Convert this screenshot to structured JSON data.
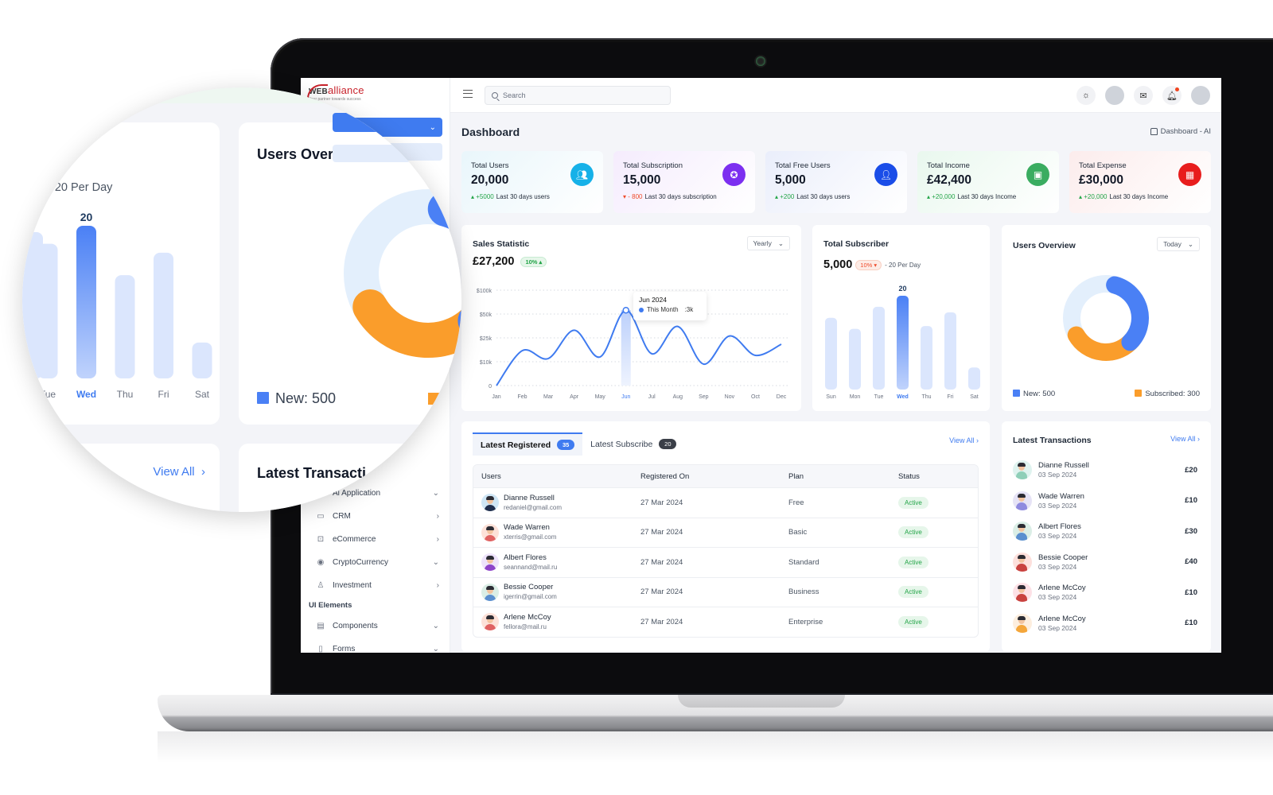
{
  "brand": {
    "name_prefix": "WEB",
    "name_suffix": "alliance",
    "tagline": "Your partner towards success"
  },
  "topbar": {
    "search_placeholder": "Search",
    "icons": [
      "sun-icon",
      "avatar-placeholder",
      "mail-icon",
      "bell-icon",
      "user-avatar"
    ]
  },
  "page": {
    "title": "Dashboard",
    "breadcrumb": "Dashboard - AI"
  },
  "sidebar": {
    "items": [
      {
        "label": "Ai Application",
        "icon": "robot-icon",
        "chevron": "down"
      },
      {
        "label": "CRM",
        "icon": "monitor-icon",
        "chevron": "right"
      },
      {
        "label": "eCommerce",
        "icon": "cart-icon",
        "chevron": "right"
      },
      {
        "label": "CryptoCurrency",
        "icon": "coin-icon",
        "chevron": "down"
      },
      {
        "label": "Investment",
        "icon": "investment-icon",
        "chevron": "right"
      }
    ],
    "section_label": "UI Elements",
    "section_items": [
      {
        "label": "Components",
        "icon": "components-icon",
        "chevron": "down"
      },
      {
        "label": "Forms",
        "icon": "forms-icon",
        "chevron": "down"
      }
    ]
  },
  "stats": [
    {
      "label": "Total Users",
      "value": "20,000",
      "delta": "+5000",
      "delta_dir": "up",
      "note": "Last 30 days users",
      "icon": "users-icon",
      "icon_color": "#16b1e8",
      "bg": "#e9f6fb"
    },
    {
      "label": "Total Subscription",
      "value": "15,000",
      "delta": "- 800",
      "delta_dir": "down",
      "note": "Last 30 days subscription",
      "icon": "award-icon",
      "icon_color": "#7c2ff0",
      "bg": "#f5ecfd"
    },
    {
      "label": "Total Free Users",
      "value": "5,000",
      "delta": "+200",
      "delta_dir": "up",
      "note": "Last 30 days users",
      "icon": "user-group-icon",
      "icon_color": "#1a4de8",
      "bg": "#eaeefb"
    },
    {
      "label": "Total Income",
      "value": "£42,400",
      "delta": "+20,000",
      "delta_dir": "up",
      "note": "Last 30 days Income",
      "icon": "wallet-icon",
      "icon_color": "#3aac60",
      "bg": "#e9f8ee"
    },
    {
      "label": "Total Expense",
      "value": "£30,000",
      "delta": "+20,000",
      "delta_dir": "up",
      "note": "Last 30 days Income",
      "icon": "expense-icon",
      "icon_color": "#e81d1d",
      "bg": "#fcecec"
    }
  ],
  "sales": {
    "title": "Sales Statistic",
    "value": "£27,200",
    "change": "10%",
    "period": "Yearly",
    "tooltip": {
      "title": "Jun 2024",
      "series": "This Month",
      "value": ":3k"
    }
  },
  "subscriber": {
    "title": "Total Subscriber",
    "value": "5,000",
    "change": "10%",
    "note": "- 20 Per Day",
    "highlight_label": "20"
  },
  "overview": {
    "title": "Users Overview",
    "period": "Today",
    "legend": [
      {
        "label": "New: 500",
        "color": "#4a80f5"
      },
      {
        "label": "Subscribed: 300",
        "color": "#fa9d2b"
      }
    ]
  },
  "registered": {
    "tabs": [
      {
        "label": "Latest Registered",
        "count": "35"
      },
      {
        "label": "Latest Subscribe",
        "count": "20"
      }
    ],
    "view_all": "View All",
    "columns": [
      "Users",
      "Registered On",
      "Plan",
      "Status"
    ],
    "rows": [
      {
        "name": "Dianne Russell",
        "email": "redaniel@gmail.com",
        "date": "27 Mar 2024",
        "plan": "Free",
        "status": "Active"
      },
      {
        "name": "Wade Warren",
        "email": "xterris@gmail.com",
        "date": "27 Mar 2024",
        "plan": "Basic",
        "status": "Active"
      },
      {
        "name": "Albert Flores",
        "email": "seannand@mail.ru",
        "date": "27 Mar 2024",
        "plan": "Standard",
        "status": "Active"
      },
      {
        "name": "Bessie Cooper",
        "email": "igerrin@gmail.com",
        "date": "27 Mar 2024",
        "plan": "Business",
        "status": "Active"
      },
      {
        "name": "Arlene McCoy",
        "email": "fellora@mail.ru",
        "date": "27 Mar 2024",
        "plan": "Enterprise",
        "status": "Active"
      }
    ]
  },
  "transactions": {
    "title": "Latest Transactions",
    "view_all": "View All",
    "rows": [
      {
        "name": "Dianne Russell",
        "date": "03 Sep 2024",
        "amount": "£20"
      },
      {
        "name": "Wade Warren",
        "date": "03 Sep 2024",
        "amount": "£10"
      },
      {
        "name": "Albert Flores",
        "date": "03 Sep 2024",
        "amount": "£30"
      },
      {
        "name": "Bessie Cooper",
        "date": "03 Sep 2024",
        "amount": "£40"
      },
      {
        "name": "Arlene McCoy",
        "date": "03 Sep 2024",
        "amount": "£10"
      },
      {
        "name": "Arlene McCoy",
        "date": "03 Sep 2024",
        "amount": "£10"
      }
    ]
  },
  "magnifier": {
    "per_day": "- 20 Per Day",
    "bar_label": "20",
    "days": [
      "Wed",
      "Thu",
      "Fri",
      "Sat"
    ],
    "overview_title": "Users Overview",
    "legend_new": "New: 500",
    "view_all": "View All",
    "transactions_title": "Latest Transacti"
  },
  "chart_data": [
    {
      "type": "line",
      "title": "Sales Statistic",
      "x": [
        "Jan",
        "Feb",
        "Mar",
        "Apr",
        "May",
        "Jun",
        "Jul",
        "Aug",
        "Sep",
        "Nov",
        "Oct",
        "Dec"
      ],
      "y_ticks": [
        "0",
        "$10k",
        "$25k",
        "$50k",
        "$100k"
      ],
      "series": [
        {
          "name": "This Month",
          "values": [
            0,
            17,
            12,
            33,
            13,
            58,
            15,
            37,
            9,
            27,
            14,
            21
          ]
        }
      ],
      "highlight": "Jun",
      "ylim": [
        0,
        100
      ],
      "grid": true
    },
    {
      "type": "bar",
      "title": "Total Subscriber",
      "categories": [
        "Sun",
        "Mon",
        "Tue",
        "Wed",
        "Thu",
        "Fri",
        "Sat"
      ],
      "values": [
        13,
        11,
        15,
        17,
        11.5,
        14,
        4
      ],
      "highlight": "Wed",
      "highlight_label": "20"
    },
    {
      "type": "pie",
      "title": "Users Overview",
      "slices": [
        {
          "label": "New",
          "value": 500,
          "color": "#4a80f5"
        },
        {
          "label": "Subscribed",
          "value": 300,
          "color": "#fa9d2b"
        },
        {
          "label": "Remaining",
          "value": 420,
          "color": "#e3effc"
        }
      ]
    }
  ]
}
